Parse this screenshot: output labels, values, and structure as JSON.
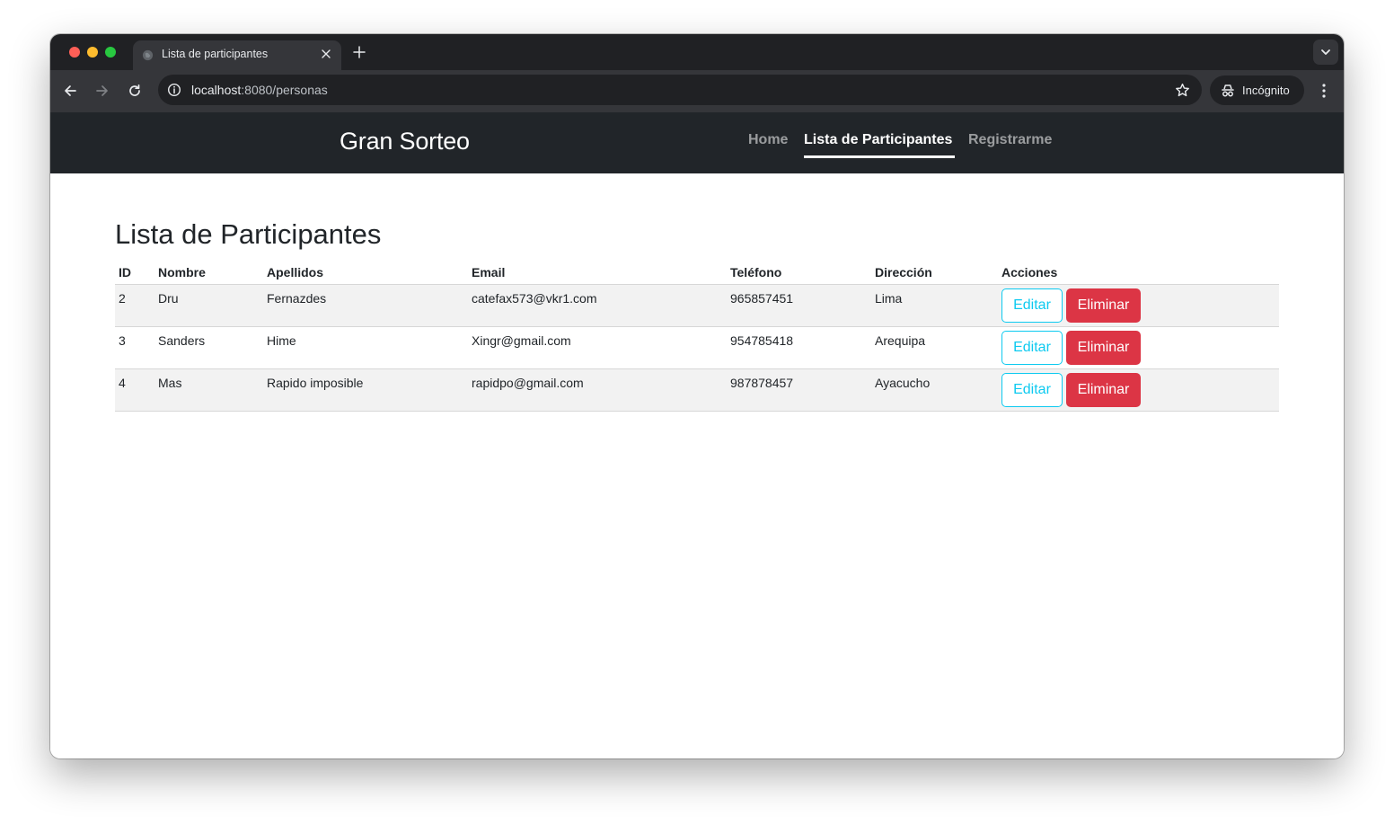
{
  "browser": {
    "tab": {
      "title": "Lista de participantes"
    },
    "address": {
      "host": "localhost",
      "rest": ":8080/personas"
    },
    "incognito_label": "Incógnito"
  },
  "site": {
    "brand": "Gran Sorteo",
    "nav": [
      {
        "label": "Home",
        "active": false
      },
      {
        "label": "Lista de Participantes",
        "active": true
      },
      {
        "label": "Registrarme",
        "active": false
      }
    ]
  },
  "main": {
    "title": "Lista de Participantes",
    "table": {
      "headers": [
        "ID",
        "Nombre",
        "Apellidos",
        "Email",
        "Teléfono",
        "Dirección",
        "Acciones"
      ],
      "rows": [
        {
          "id": "2",
          "nombre": "Dru",
          "apellidos": "Fernazdes",
          "email": "catefax573@vkr1.com",
          "telefono": "965857451",
          "direccion": "Lima"
        },
        {
          "id": "3",
          "nombre": "Sanders",
          "apellidos": "Hime",
          "email": "Xingr@gmail.com",
          "telefono": "954785418",
          "direccion": "Arequipa"
        },
        {
          "id": "4",
          "nombre": "Mas",
          "apellidos": "Rapido imposible",
          "email": "rapidpo@gmail.com",
          "telefono": "987878457",
          "direccion": "Ayacucho"
        }
      ],
      "actions": {
        "edit": "Editar",
        "delete": "Eliminar"
      }
    }
  },
  "colors": {
    "navbar": "#212529",
    "edit_button": "#0dcaf0",
    "delete_button": "#dc3545",
    "row_stripe": "#f2f2f2"
  },
  "icons": {
    "window_controls": [
      "close-dot",
      "minimize-dot",
      "zoom-dot"
    ],
    "tab": [
      "globe-icon",
      "close-icon",
      "plus-icon",
      "chevron-down-icon"
    ],
    "toolbar": [
      "back-arrow-icon",
      "forward-arrow-icon",
      "reload-icon",
      "info-icon",
      "star-icon",
      "incognito-icon",
      "kebab-menu-icon"
    ]
  }
}
